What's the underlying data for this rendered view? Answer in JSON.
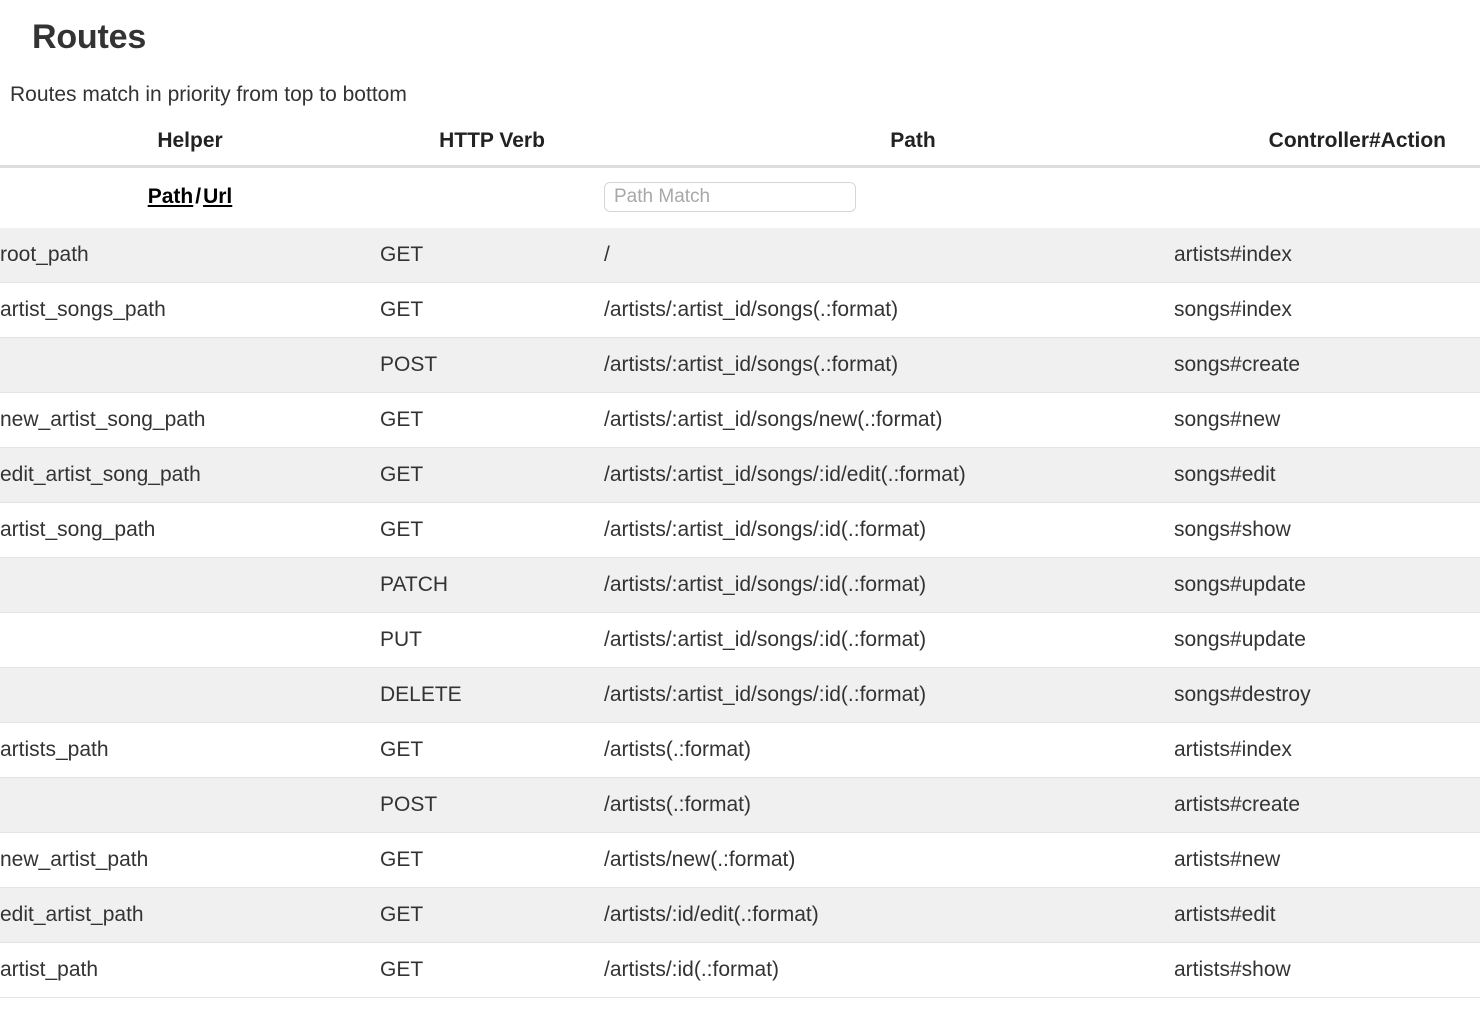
{
  "header": {
    "title": "Routes",
    "subtitle": "Routes match in priority from top to bottom"
  },
  "table": {
    "columns": [
      "Helper",
      "HTTP Verb",
      "Path",
      "Controller#Action"
    ],
    "helper_toggle": {
      "path_label": "Path",
      "separator": "/",
      "url_label": "Url"
    },
    "search": {
      "placeholder": "Path Match",
      "value": ""
    },
    "rows": [
      {
        "helper": "root_path",
        "verb": "GET",
        "path": "/",
        "controller_action": "artists#index"
      },
      {
        "helper": "artist_songs_path",
        "verb": "GET",
        "path": "/artists/:artist_id/songs(.:format)",
        "controller_action": "songs#index"
      },
      {
        "helper": "",
        "verb": "POST",
        "path": "/artists/:artist_id/songs(.:format)",
        "controller_action": "songs#create"
      },
      {
        "helper": "new_artist_song_path",
        "verb": "GET",
        "path": "/artists/:artist_id/songs/new(.:format)",
        "controller_action": "songs#new"
      },
      {
        "helper": "edit_artist_song_path",
        "verb": "GET",
        "path": "/artists/:artist_id/songs/:id/edit(.:format)",
        "controller_action": "songs#edit"
      },
      {
        "helper": "artist_song_path",
        "verb": "GET",
        "path": "/artists/:artist_id/songs/:id(.:format)",
        "controller_action": "songs#show"
      },
      {
        "helper": "",
        "verb": "PATCH",
        "path": "/artists/:artist_id/songs/:id(.:format)",
        "controller_action": "songs#update"
      },
      {
        "helper": "",
        "verb": "PUT",
        "path": "/artists/:artist_id/songs/:id(.:format)",
        "controller_action": "songs#update"
      },
      {
        "helper": "",
        "verb": "DELETE",
        "path": "/artists/:artist_id/songs/:id(.:format)",
        "controller_action": "songs#destroy"
      },
      {
        "helper": "artists_path",
        "verb": "GET",
        "path": "/artists(.:format)",
        "controller_action": "artists#index"
      },
      {
        "helper": "",
        "verb": "POST",
        "path": "/artists(.:format)",
        "controller_action": "artists#create"
      },
      {
        "helper": "new_artist_path",
        "verb": "GET",
        "path": "/artists/new(.:format)",
        "controller_action": "artists#new"
      },
      {
        "helper": "edit_artist_path",
        "verb": "GET",
        "path": "/artists/:id/edit(.:format)",
        "controller_action": "artists#edit"
      },
      {
        "helper": "artist_path",
        "verb": "GET",
        "path": "/artists/:id(.:format)",
        "controller_action": "artists#show"
      }
    ]
  }
}
